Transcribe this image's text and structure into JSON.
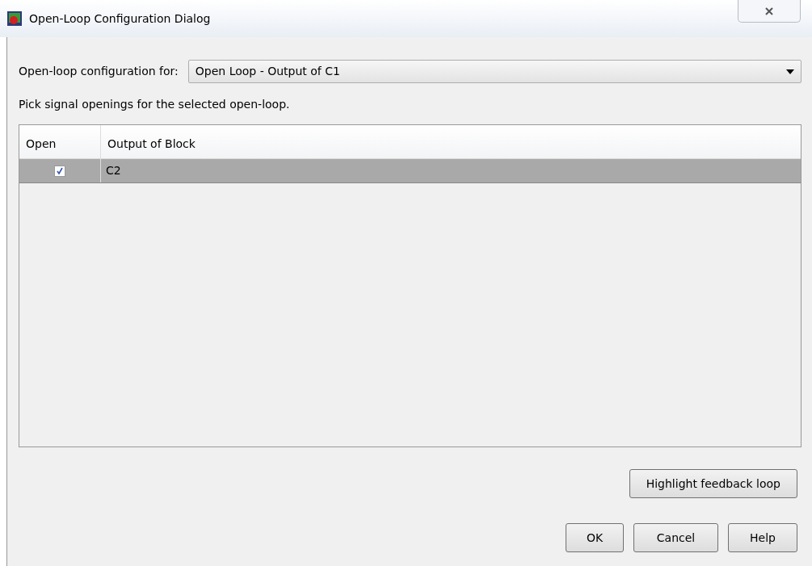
{
  "window": {
    "title": "Open-Loop Configuration Dialog"
  },
  "config": {
    "label": "Open-loop configuration for:",
    "value": "Open Loop - Output of C1"
  },
  "instruction": "Pick signal openings for the selected open-loop.",
  "table": {
    "columns": [
      "Open",
      "Output of Block"
    ],
    "rows": [
      {
        "open": true,
        "block": "C2",
        "selected": true
      }
    ]
  },
  "highlight_button": "Highlight feedback loop",
  "buttons": [
    "OK",
    "Cancel",
    "Help"
  ]
}
